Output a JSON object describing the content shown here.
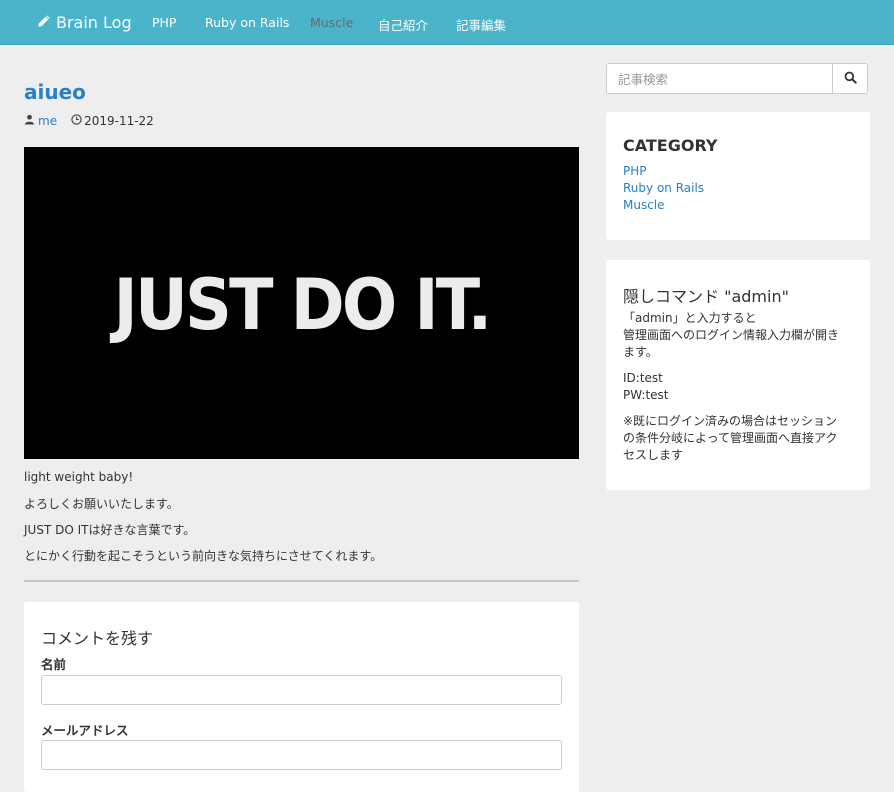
{
  "navbar": {
    "brand": "Brain Log",
    "brand_icon": "pencil-icon",
    "items": [
      {
        "label": "PHP"
      },
      {
        "label": "Ruby on Rails"
      },
      {
        "label": "Muscle"
      },
      {
        "label": "自己紹介"
      },
      {
        "label": "記事編集"
      }
    ]
  },
  "post": {
    "title": "aiueo",
    "author": "me",
    "date": "2019-11-22",
    "image_text": "JUST DO IT.",
    "paragraphs": [
      "light weight baby!",
      "よろしくお願いいたします。",
      "JUST DO ITは好きな言葉です。",
      "とにかく行動を起こそうという前向きな気持ちにさせてくれます。"
    ]
  },
  "comment_form": {
    "title": "コメントを残す",
    "name_label": "名前",
    "email_label": "メールアドレス",
    "name_value": "",
    "email_value": ""
  },
  "sidebar": {
    "search_placeholder": "記事検索",
    "category": {
      "title": "CATEGORY",
      "items": [
        "PHP",
        "Ruby on Rails",
        "Muscle"
      ]
    },
    "hidden": {
      "title": "隠しコマンド \"admin\"",
      "line1": "「admin」と入力すると",
      "line2": "管理画面へのログイン情報入力欄が開き",
      "line3": "ます。",
      "id": "ID:test",
      "pw": "PW:test",
      "note1": "※既にログイン済みの場合はセッション",
      "note2": "の条件分岐によって管理画面へ直接アク",
      "note3": "セスします"
    }
  },
  "colors": {
    "navbar": "#4ab4cb",
    "link": "#2a7fc6",
    "background": "#eeeeee"
  }
}
